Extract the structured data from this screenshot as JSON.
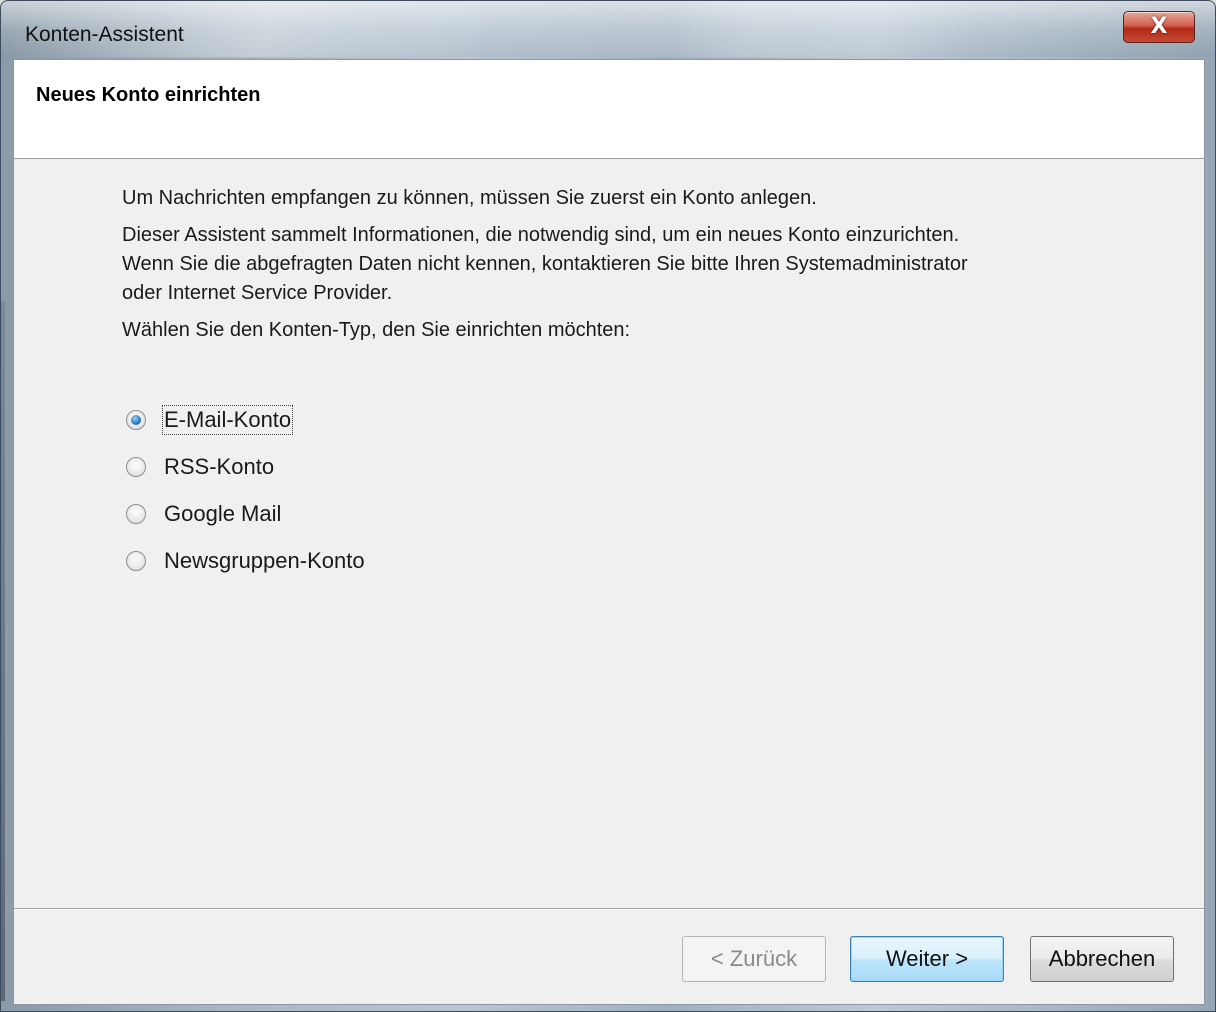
{
  "window": {
    "title": "Konten-Assistent",
    "close_label": "X"
  },
  "header": {
    "title": "Neues Konto einrichten"
  },
  "content": {
    "intro": "Um Nachrichten empfangen zu können, müssen Sie zuerst ein Konto anlegen.",
    "info_line1": "Dieser Assistent sammelt Informationen, die notwendig sind, um ein neues Konto einzurichten.",
    "info_line2": "Wenn Sie die abgefragten Daten nicht kennen, kontaktieren Sie bitte Ihren Systemadministrator",
    "info_line3": "oder Internet Service Provider.",
    "prompt": "Wählen Sie den Konten-Typ, den Sie einrichten möchten:"
  },
  "account_types": [
    {
      "label": "E-Mail-Konto",
      "selected": true
    },
    {
      "label": "RSS-Konto",
      "selected": false
    },
    {
      "label": "Google Mail",
      "selected": false
    },
    {
      "label": "Newsgruppen-Konto",
      "selected": false
    }
  ],
  "buttons": {
    "back": "< Zurück",
    "next": "Weiter >",
    "cancel": "Abbrechen"
  },
  "colors": {
    "client_bg": "#f0f0f0",
    "header_bg": "#ffffff",
    "radio_selected": "#2d7dc8",
    "close_button": "#c64a33",
    "default_button_border": "#3c7fb1"
  }
}
